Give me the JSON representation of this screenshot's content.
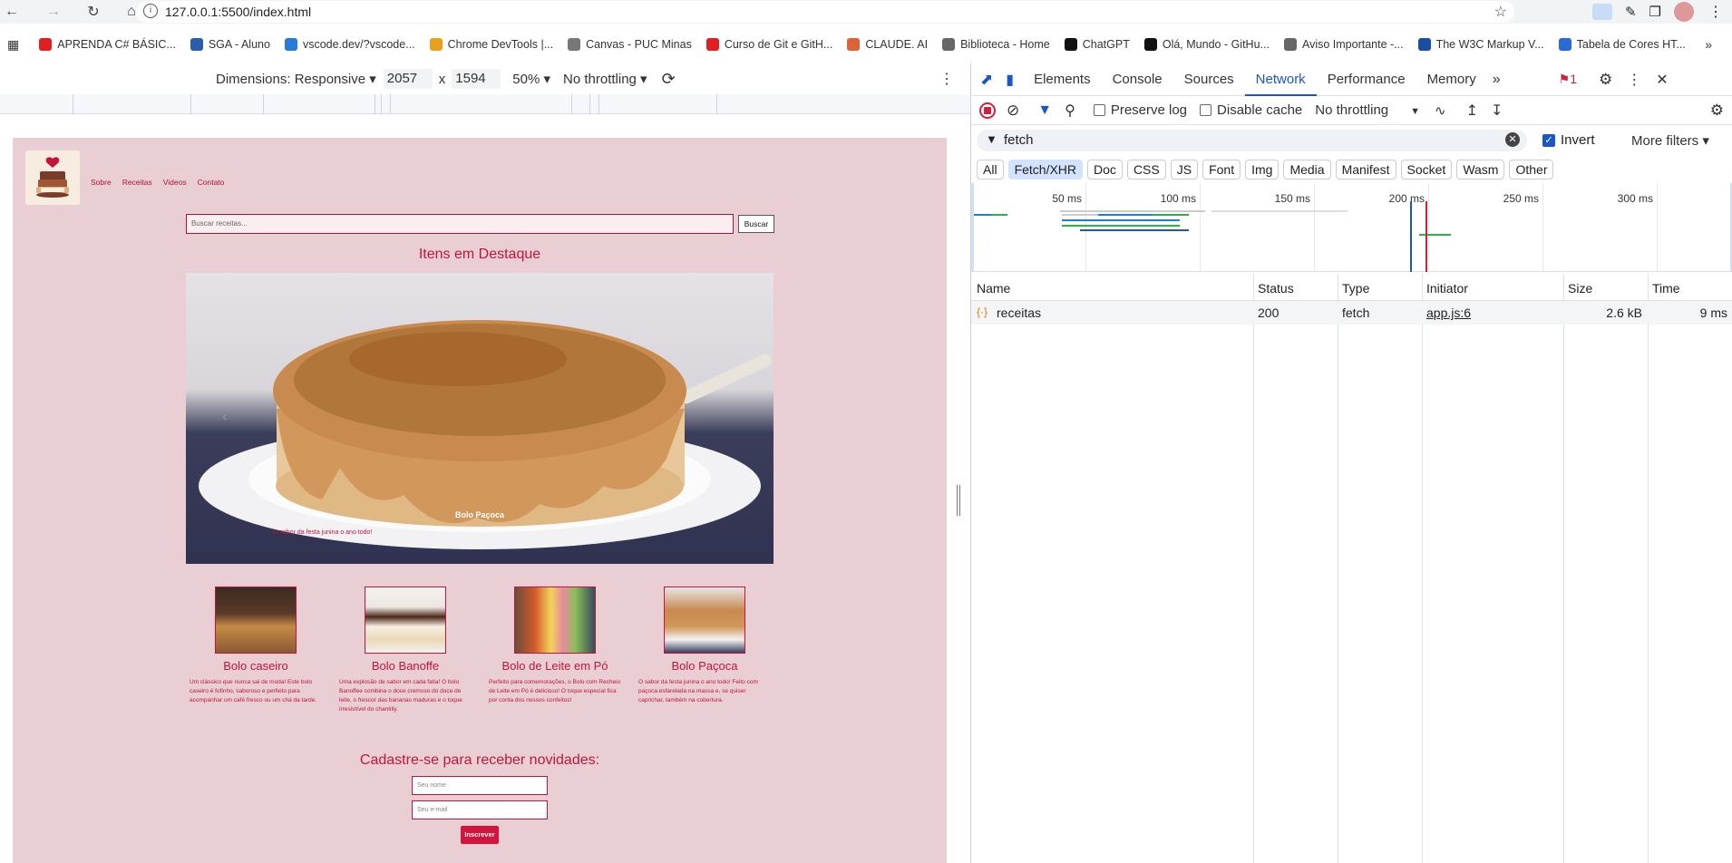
{
  "browser": {
    "url": "127.0.0.1:5500/index.html",
    "bookmarks": [
      {
        "label": "APRENDA C# BÁSIC...",
        "color": "#e02020"
      },
      {
        "label": "SGA - Aluno",
        "color": "#2b5da8"
      },
      {
        "label": "vscode.dev/?vscode...",
        "color": "#2a7bd4"
      },
      {
        "label": "Chrome DevTools |...",
        "color": "#e8a020"
      },
      {
        "label": "Canvas - PUC Minas",
        "color": "#777777"
      },
      {
        "label": "Curso de Git e GitH...",
        "color": "#e02020"
      },
      {
        "label": "CLAUDE. AI",
        "color": "#d9643a"
      },
      {
        "label": "Biblioteca - Home",
        "color": "#666666"
      },
      {
        "label": "ChatGPT",
        "color": "#111111"
      },
      {
        "label": "Olá, Mundo - GitHu...",
        "color": "#111111"
      },
      {
        "label": "Aviso Importante -...",
        "color": "#666666"
      },
      {
        "label": "The W3C Markup V...",
        "color": "#1a4fa0"
      },
      {
        "label": "Tabela de Cores HT...",
        "color": "#2a6ad4"
      }
    ]
  },
  "device_toolbar": {
    "dimensions_label": "Dimensions: Responsive",
    "width": "2057",
    "times": "x",
    "height": "1594",
    "zoom": "50%",
    "throttling": "No throttling"
  },
  "site": {
    "nav": [
      "Sobre",
      "Receitas",
      "Videos",
      "Contato"
    ],
    "search_placeholder": "Buscar receitas...",
    "search_button": "Buscar",
    "featured_title": "Itens em Destaque",
    "hero_caption": "Bolo Paçoca",
    "hero_subcaption": "O sabor da festa junina o ano todo!",
    "cards": [
      {
        "title": "Bolo caseiro",
        "desc": "Um clássico que nunca sai de moda! Este bolo caseiro é fofinho, saboroso e perfeito para acompanhar um café fresco ou um chá da tarde."
      },
      {
        "title": "Bolo Banoffe",
        "desc": "Uma explosão de sabor em cada fatia! O bolo Banoffee combina o doce cremoso do doce de leite, o frescor das bananas maduras e o toque irresistível do chantilly."
      },
      {
        "title": "Bolo de Leite em Pó",
        "desc": "Perfeito para comemorações, o Bolo com Recheio de Leite em Pó é delicioso! O toque especial fica por conta dos nossos confeitos!"
      },
      {
        "title": "Bolo Paçoca",
        "desc": "O sabor da festa junina o ano todo! Feito com paçoca esfarelada na massa e, se quiser caprichar, também na cobertura."
      }
    ],
    "newsletter_title": "Cadastre-se para receber novidades:",
    "name_placeholder": "Seu nome",
    "email_placeholder": "Seu e-mail",
    "subscribe_button": "Inscrever"
  },
  "devtools": {
    "tabs": [
      "Elements",
      "Console",
      "Sources",
      "Network",
      "Performance",
      "Memory"
    ],
    "active_tab": "Network",
    "issues_count": "1",
    "preserve_log": "Preserve log",
    "disable_cache": "Disable cache",
    "throttling": "No throttling",
    "filter_value": "fetch",
    "invert_label": "Invert",
    "more_filters": "More filters",
    "type_filters": [
      "All",
      "Fetch/XHR",
      "Doc",
      "CSS",
      "JS",
      "Font",
      "Img",
      "Media",
      "Manifest",
      "Socket",
      "Wasm",
      "Other"
    ],
    "active_type": "Fetch/XHR",
    "timeline_ticks": [
      "50 ms",
      "100 ms",
      "150 ms",
      "200 ms",
      "250 ms",
      "300 ms"
    ],
    "columns": [
      "Name",
      "Status",
      "Type",
      "Initiator",
      "Size",
      "Time"
    ],
    "rows": [
      {
        "name": "receitas",
        "status": "200",
        "type": "fetch",
        "initiator": "app.js:6",
        "size": "2.6 kB",
        "time": "9 ms"
      }
    ]
  }
}
